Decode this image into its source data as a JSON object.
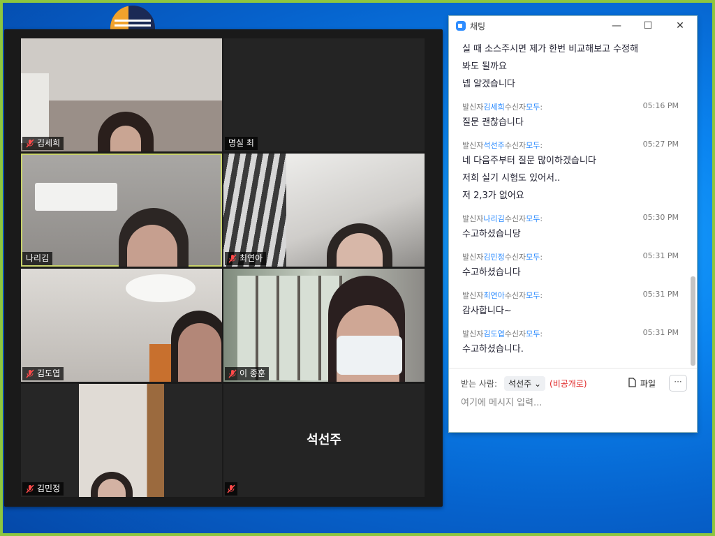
{
  "zoom": {
    "tiles": [
      {
        "name": "김세희",
        "muted": true
      },
      {
        "name": "명실 최",
        "muted": false
      },
      {
        "name": "나리김",
        "muted": false
      },
      {
        "name": "최연아",
        "muted": true
      },
      {
        "name": "김도엽",
        "muted": true
      },
      {
        "name": "이 종훈",
        "muted": true
      },
      {
        "name": "김민정",
        "muted": true
      },
      {
        "name": "석선주",
        "muted": true
      }
    ]
  },
  "chat": {
    "title": "채팅",
    "minimize": "—",
    "maximize": "☐",
    "close": "✕",
    "top_lines": [
      "실 때 소스주시면 제가 한번 비교해보고 수정해",
      "봐도 될까요",
      "넵 알겠습니다"
    ],
    "messages": [
      {
        "prefix": "발신자",
        "from": "김세희",
        "mid": "수신자",
        "to": "모두",
        "suffix": ":",
        "time": "05:16 PM",
        "lines": [
          "질문 괜찮습니다"
        ]
      },
      {
        "prefix": "발신자",
        "from": "석선주",
        "mid": "수신자",
        "to": "모두",
        "suffix": ":",
        "time": "05:27 PM",
        "lines": [
          "네 다음주부터 질문 많이하겠습니다",
          "저희 실기 시험도 있어서..",
          "저 2,3가 없어요"
        ]
      },
      {
        "prefix": "발신자",
        "from": "나리김",
        "mid": "수신자",
        "to": "모두",
        "suffix": ":",
        "time": "05:30 PM",
        "lines": [
          "수고하셨습니당"
        ]
      },
      {
        "prefix": "발신자",
        "from": "김민정",
        "mid": "수신자",
        "to": "모두",
        "suffix": ":",
        "time": "05:31 PM",
        "lines": [
          "수고하셨습니다"
        ]
      },
      {
        "prefix": "발신자",
        "from": "최연아",
        "mid": "수신자",
        "to": "모두",
        "suffix": ":",
        "time": "05:31 PM",
        "lines": [
          "감사합니다~"
        ]
      },
      {
        "prefix": "발신자",
        "from": "김도엽",
        "mid": "수신자",
        "to": "모두",
        "suffix": ":",
        "time": "05:31 PM",
        "lines": [
          "수고하셨습니다."
        ]
      }
    ],
    "to_label": "받는 사람:",
    "to_value": "석선주",
    "to_private": "(비공개로)",
    "file_label": "파일",
    "more_label": "···",
    "input_placeholder": "여기에 메시지 입력..."
  },
  "colors": {
    "accent": "#2d8cff",
    "private": "#e02828",
    "desktop_border": "#8dc63f"
  }
}
